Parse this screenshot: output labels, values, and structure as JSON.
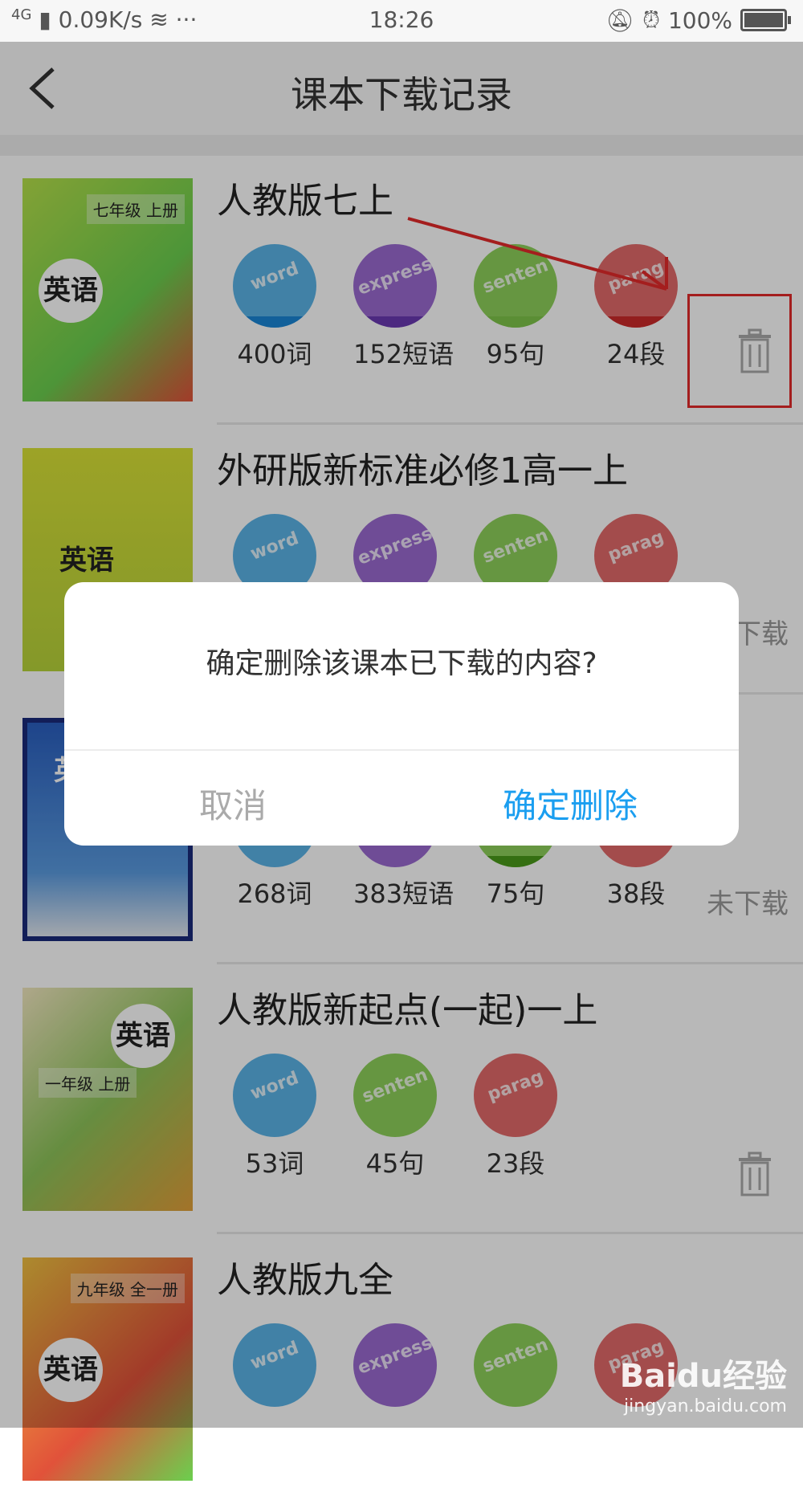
{
  "statusbar": {
    "network": "4G",
    "speed": "0.09K/s",
    "dots": "···",
    "time": "18:26",
    "battery": "100%"
  },
  "header": {
    "title": "课本下载记录",
    "back_icon": "chevron-left-icon"
  },
  "items": [
    {
      "name": "人教版七上",
      "cover_title": "英语",
      "cover_sub": "七年级 上册",
      "counts": [
        "400词",
        "152短语",
        "95句",
        "24段"
      ],
      "status": "",
      "colors": [
        "#5bb3e6",
        "#8a56c4",
        "#7ec54a",
        "#e05a5a"
      ],
      "bars": [
        "#1a86d6",
        "#6a3ab2",
        "#7ec54a",
        "#cc2a2a"
      ]
    },
    {
      "name": "外研版新标准必修1高一上",
      "cover_title": "英语",
      "cover_sub": "",
      "counts": [],
      "status": "下载"
    },
    {
      "name": "",
      "cover_title": "英",
      "cover_sub": "",
      "counts": [
        "268词",
        "383短语",
        "75句",
        "38段"
      ],
      "status": "未下载"
    },
    {
      "name": "人教版新起点(一起)一上",
      "cover_title": "英语",
      "cover_sub": "一年级 上册",
      "counts": [
        "53词",
        "45句",
        "23段"
      ],
      "status": ""
    },
    {
      "name": "人教版九全",
      "cover_title": "英语",
      "cover_sub": "九年级 全一册",
      "counts": [],
      "status": ""
    }
  ],
  "dialog": {
    "message": "确定删除该课本已下载的内容?",
    "cancel": "取消",
    "confirm": "确定删除"
  },
  "watermark": {
    "line1": "Baidu经验",
    "line2": "jingyan.baidu.com"
  },
  "colors": {
    "accent": "#1a9ef0",
    "annotation": "#e42a2a"
  }
}
